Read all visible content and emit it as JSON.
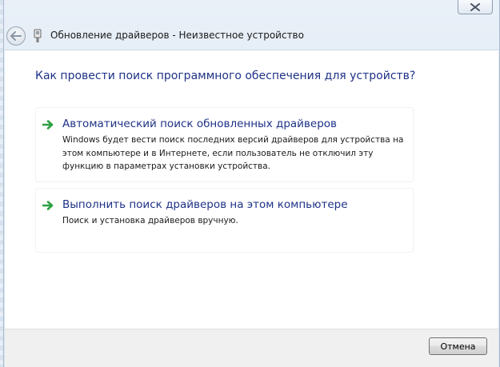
{
  "window": {
    "title": "Обновление драйверов - Неизвестное устройство"
  },
  "icons": {
    "close": "close-icon",
    "back": "back-arrow-icon",
    "device": "device-icon",
    "option_arrow": "green-arrow-icon"
  },
  "colors": {
    "heading": "#1e3287",
    "arrow": "#2ea043",
    "close_x": "#4a5566"
  },
  "main": {
    "heading": "Как провести поиск программного обеспечения для устройств?",
    "options": [
      {
        "title": "Автоматический поиск обновленных драйверов",
        "description": "Windows будет вести поиск последних версий драйверов для устройства на этом компьютере и в Интернете, если пользователь не отключил эту функцию в параметрах установки устройства."
      },
      {
        "title": "Выполнить поиск драйверов на этом компьютере",
        "description": "Поиск и установка драйверов вручную."
      }
    ]
  },
  "footer": {
    "cancel_label": "Отмена"
  }
}
